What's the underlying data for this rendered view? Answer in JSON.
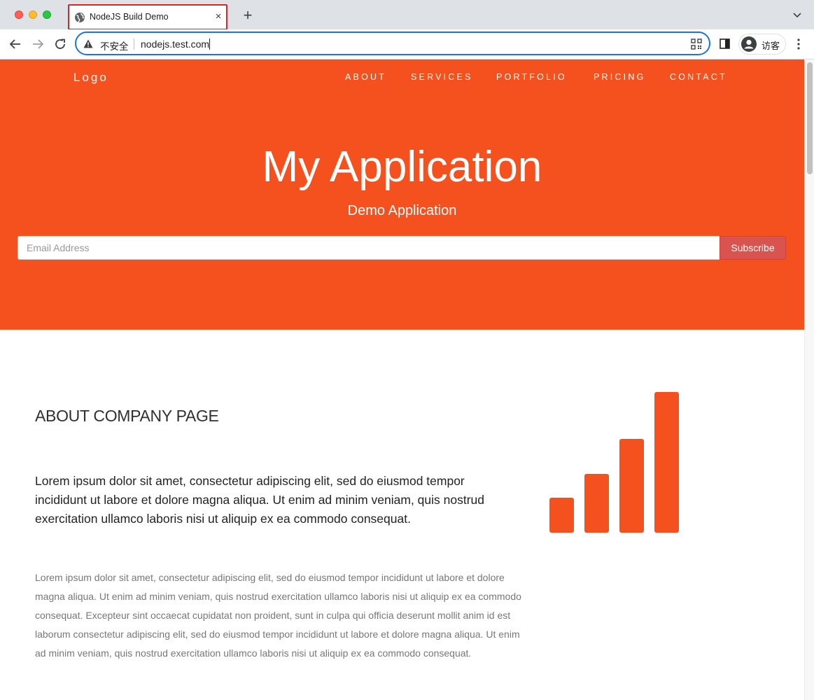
{
  "browser": {
    "tab_title": "NodeJS Build Demo",
    "tab_close": "×",
    "new_tab": "+",
    "security_label": "不安全",
    "url": "nodejs.test.com",
    "profile_label": "访客",
    "accent_color": "#1a73e8"
  },
  "site": {
    "logo": "Logo",
    "nav": [
      "ABOUT",
      "SERVICES",
      "PORTFOLIO",
      "PRICING",
      "CONTACT"
    ],
    "hero_title": "My Application",
    "hero_subtitle": "Demo Application",
    "email_placeholder": "Email Address",
    "subscribe_label": "Subscribe",
    "brand_color": "#f4511e",
    "button_color": "#d9534f"
  },
  "about": {
    "heading": "ABOUT COMPANY PAGE",
    "lead": "Lorem ipsum dolor sit amet, consectetur adipiscing elit, sed do eiusmod tempor incididunt ut labore et dolore magna aliqua. Ut enim ad minim veniam, quis nostrud exercitation ullamco laboris nisi ut aliquip ex ea commodo consequat.",
    "body": "Lorem ipsum dolor sit amet, consectetur adipiscing elit, sed do eiusmod tempor incididunt ut labore et dolore magna aliqua. Ut enim ad minim veniam, quis nostrud exercitation ullamco laboris nisi ut aliquip ex ea commodo consequat. Excepteur sint occaecat cupidatat non proident, sunt in culpa qui officia deserunt mollit anim id est laborum consectetur adipiscing elit, sed do eiusmod tempor incididunt ut labore et dolore magna aliqua. Ut enim ad minim veniam, quis nostrud exercitation ullamco laboris nisi ut aliquip ex ea commodo consequat.",
    "icon": "signal-icon"
  }
}
